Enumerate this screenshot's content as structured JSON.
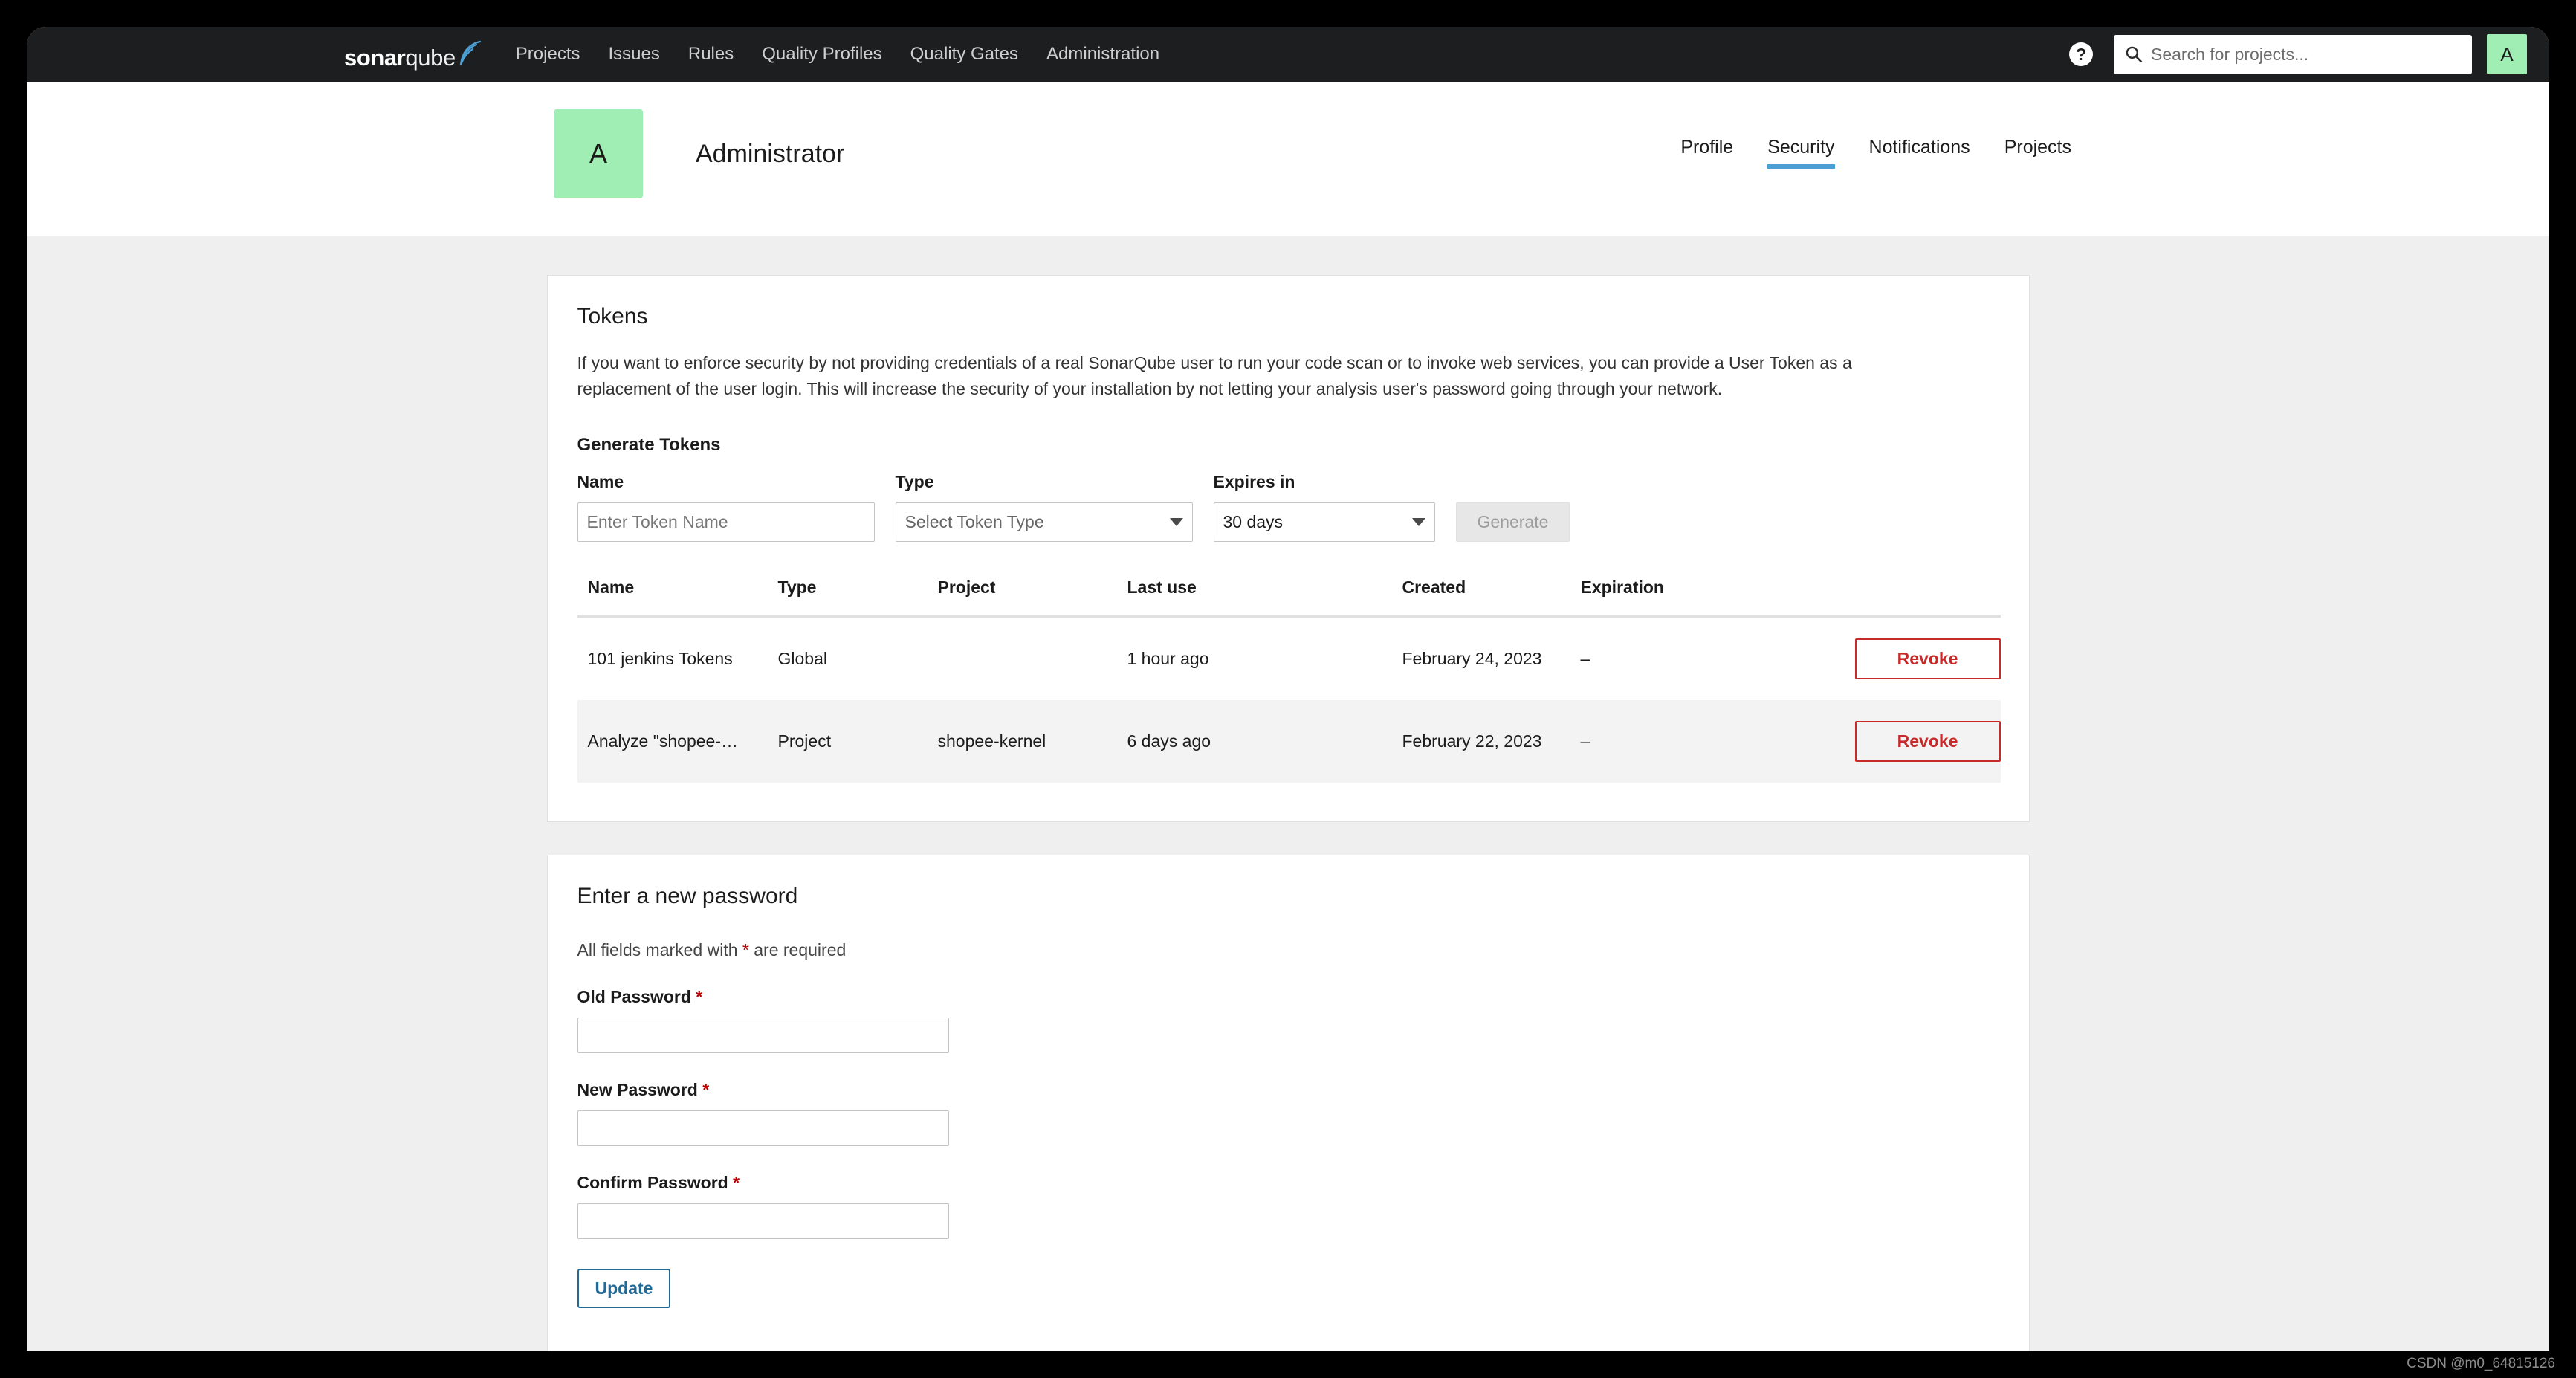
{
  "topnav": {
    "logo": {
      "bold_part": "sonar",
      "light_part": "qube",
      "swoosh_color": "#4B9FD5"
    },
    "items": [
      {
        "label": "Projects"
      },
      {
        "label": "Issues"
      },
      {
        "label": "Rules"
      },
      {
        "label": "Quality Profiles"
      },
      {
        "label": "Quality Gates"
      },
      {
        "label": "Administration"
      }
    ],
    "help_icon": "question-mark-icon",
    "search": {
      "placeholder": "Search for projects...",
      "value": "",
      "icon": "search-icon"
    },
    "avatar": {
      "initial": "A",
      "color": "#A0EEB4"
    }
  },
  "profile": {
    "avatar_initial": "A",
    "avatar_color": "#A0EEB4",
    "name": "Administrator",
    "tabs": [
      {
        "label": "Profile",
        "active": false
      },
      {
        "label": "Security",
        "active": true
      },
      {
        "label": "Notifications",
        "active": false
      },
      {
        "label": "Projects",
        "active": false
      }
    ],
    "active_tab_color": "#4B9FD5"
  },
  "tokens_card": {
    "title": "Tokens",
    "description": "If you want to enforce security by not providing credentials of a real SonarQube user to run your code scan or to invoke web services, you can provide a User Token as a replacement of the user login. This will increase the security of your installation by not letting your analysis user's password going through your network.",
    "generate_section_title": "Generate Tokens",
    "form": {
      "name_label": "Name",
      "name_placeholder": "Enter Token Name",
      "name_value": "",
      "type_label": "Type",
      "type_value": "Select Token Type",
      "type_is_placeholder": true,
      "expires_label": "Expires in",
      "expires_value": "30 days",
      "generate_label": "Generate",
      "generate_disabled": true
    },
    "table": {
      "headers": [
        "Name",
        "Type",
        "Project",
        "Last use",
        "Created",
        "Expiration",
        ""
      ],
      "rows": [
        {
          "name": "101 jenkins Tokens",
          "type": "Global",
          "project": "",
          "last_use": "1 hour ago",
          "created": "February 24, 2023",
          "expiration": "–",
          "action_label": "Revoke"
        },
        {
          "name": "Analyze \"shopee-…",
          "type": "Project",
          "project": "shopee-kernel",
          "last_use": "6 days ago",
          "created": "February 22, 2023",
          "expiration": "–",
          "action_label": "Revoke"
        }
      ],
      "revoke_color": "#C72A2A"
    }
  },
  "password_card": {
    "title": "Enter a new password",
    "required_note_prefix": "All fields marked with ",
    "required_star": "*",
    "required_note_suffix": " are required",
    "fields": [
      {
        "label": "Old Password",
        "required": "*",
        "value": ""
      },
      {
        "label": "New Password",
        "required": "*",
        "value": ""
      },
      {
        "label": "Confirm Password",
        "required": "*",
        "value": ""
      }
    ],
    "update_label": "Update",
    "update_color": "#236A97"
  },
  "watermark": {
    "text": "CSDN @m0_64815126"
  }
}
